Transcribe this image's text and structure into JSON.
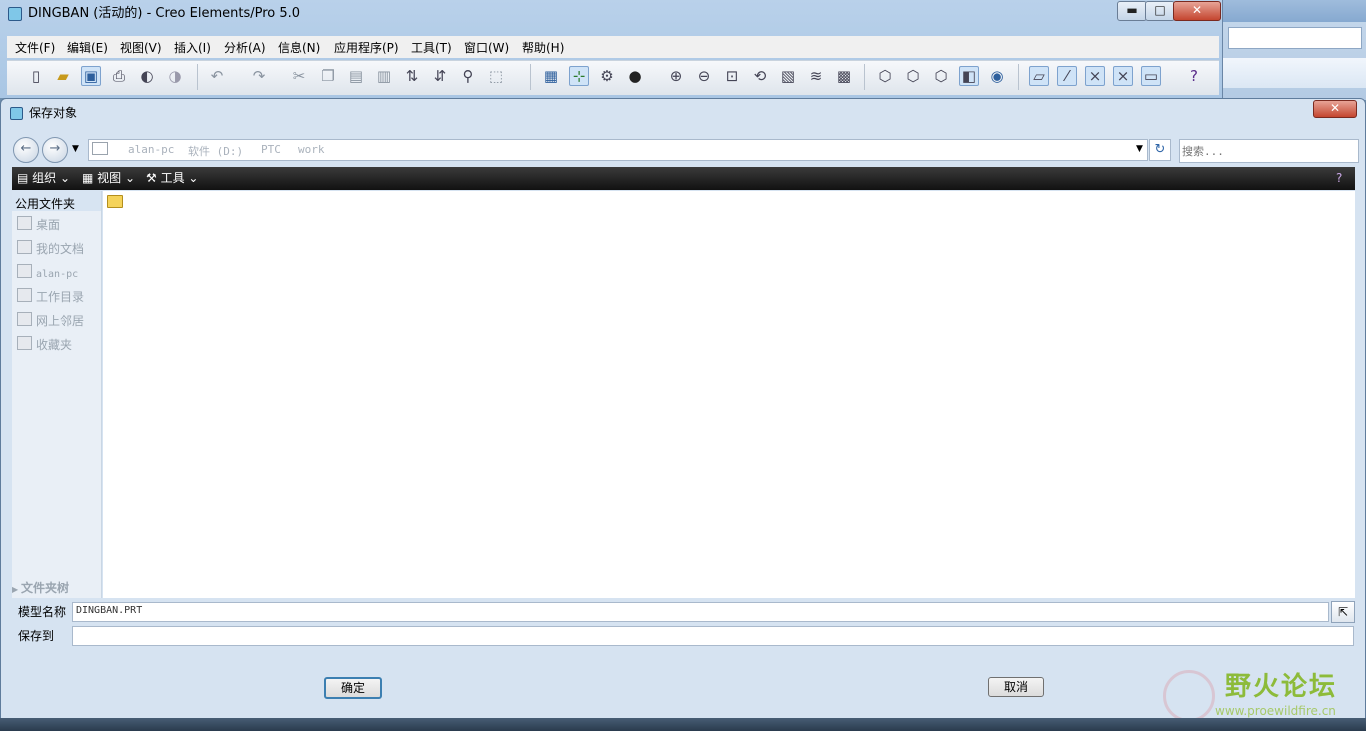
{
  "creo_window": {
    "title": "DINGBAN (活动的) - Creo Elements/Pro 5.0",
    "min": "▬",
    "max": "□",
    "close": "✕"
  },
  "menu": [
    "文件(F)",
    "编辑(E)",
    "视图(V)",
    "插入(I)",
    "分析(A)",
    "信息(N)",
    "应用程序(P)",
    "工具(T)",
    "窗口(W)",
    "帮助(H)"
  ],
  "toolbar_icons": [
    "new-icon",
    "open-icon",
    "save-icon",
    "print-icon",
    "send-icon",
    "send-all-icon",
    "undo-icon",
    "redo-icon",
    "cut-icon",
    "copy-icon",
    "paste-icon",
    "paste-special-icon",
    "regenerate-icon",
    "regen-manager-icon",
    "find-icon",
    "select-box-icon",
    "repaint-icon",
    "spin-center-icon",
    "orient-mode-icon",
    "appearance-icon",
    "zoom-in-icon",
    "zoom-out-icon",
    "refit-icon",
    "reorient-icon",
    "saved-views-icon",
    "layers-icon",
    "view-manager-icon",
    "wireframe-icon",
    "hidden-line-icon",
    "no-hidden-icon",
    "shading-icon",
    "enhanced-realism-icon",
    "datum-planes-icon",
    "datum-axes-icon",
    "datum-points-icon",
    "csys-icon",
    "annotation-icon",
    "whats-this-icon"
  ],
  "dialog": {
    "title": "保存对象",
    "close": "✕",
    "nav": {
      "back": "←",
      "forward": "→",
      "breadcrumbs": [
        "alan-pc",
        "软件 (D:)",
        "PTC",
        "work"
      ],
      "refresh": "↻",
      "search_placeholder": "搜索..."
    },
    "commands": {
      "organize": "组织",
      "views": "视图",
      "tools": "工具",
      "help": "?"
    },
    "sidebar": {
      "header": "公用文件夹",
      "items": [
        "桌面",
        "我的文档",
        "alan-pc",
        "工作目录",
        "网上邻居",
        "收藏夹"
      ],
      "folder_tree": "文件夹树"
    },
    "model_name_label": "模型名称",
    "model_name_value": "DINGBAN.PRT",
    "save_to_label": "保存到",
    "save_to_value": "",
    "ok": "确定",
    "cancel": "取消"
  },
  "watermark": {
    "name": "野火论坛",
    "url": "www.proewildfire.cn"
  },
  "colors": {
    "title_bar": "#b9d1ea",
    "close_red": "#c4452f",
    "command_bar": "#1f1f1f",
    "watermark_green": "#8dbb3a"
  }
}
